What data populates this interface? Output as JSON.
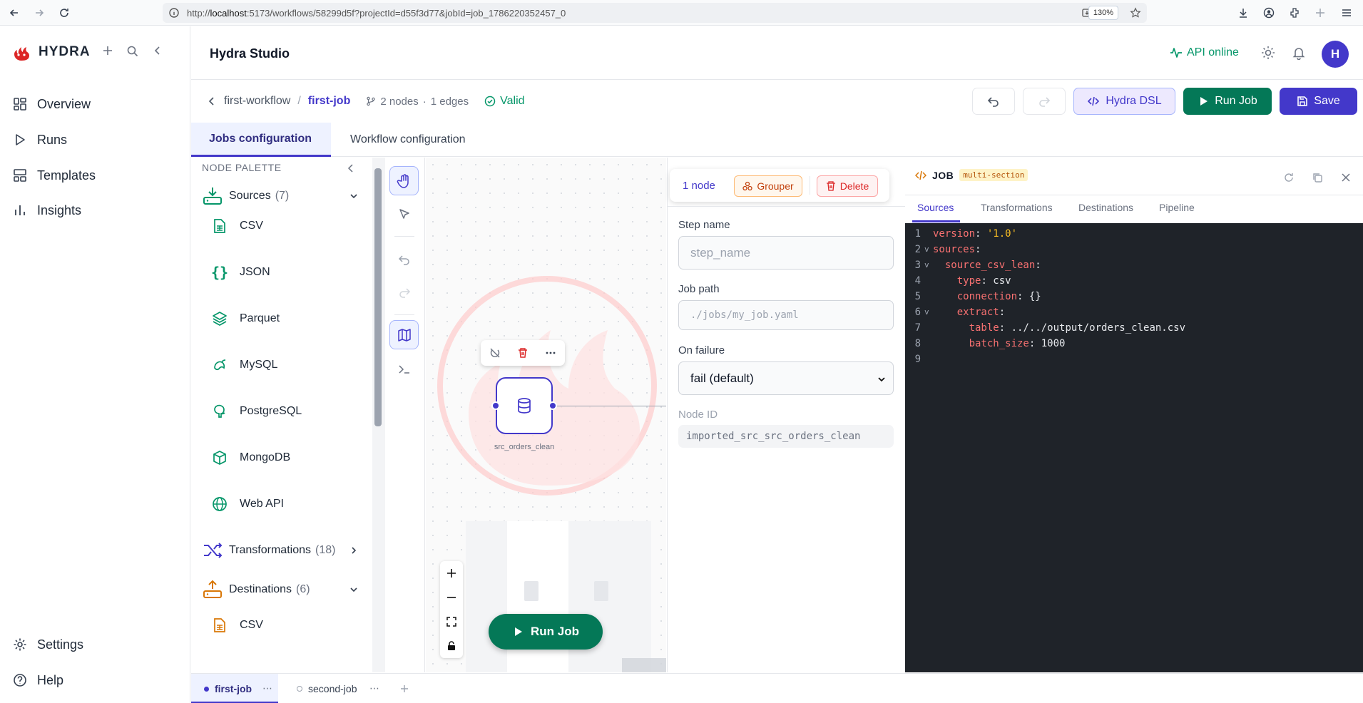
{
  "browser": {
    "url_prefix": "http://",
    "url_host": "localhost",
    "url_rest": ":5173/workflows/58299d5f?projectId=d55f3d77&jobId=job_1786220352457_0",
    "zoom": "130%"
  },
  "sidebar": {
    "brand": "HYDRA",
    "items": [
      {
        "label": "Overview",
        "icon": "grid-icon"
      },
      {
        "label": "Runs",
        "icon": "play-icon"
      },
      {
        "label": "Templates",
        "icon": "layout-icon"
      },
      {
        "label": "Insights",
        "icon": "bar-chart-icon"
      }
    ],
    "footer": [
      {
        "label": "Settings",
        "icon": "gear-icon"
      },
      {
        "label": "Help",
        "icon": "help-icon"
      }
    ]
  },
  "header": {
    "title": "Hydra Studio",
    "api_status": "API online",
    "avatar_initial": "H"
  },
  "toolbar": {
    "breadcrumb_workflow": "first-workflow",
    "breadcrumb_sep": "/",
    "breadcrumb_job": "first-job",
    "nodes": "2 nodes",
    "dot": "·",
    "edges": "1 edges",
    "status": "Valid",
    "dsl_label": "Hydra DSL",
    "run_label": "Run Job",
    "save_label": "Save"
  },
  "tabs": {
    "jobs": "Jobs configuration",
    "workflow": "Workflow configuration"
  },
  "palette": {
    "heading": "NODE PALETTE",
    "sources": {
      "label": "Sources",
      "count": "(7)"
    },
    "source_items": [
      "CSV",
      "JSON",
      "Parquet",
      "MySQL",
      "PostgreSQL",
      "MongoDB",
      "Web API"
    ],
    "transformations": {
      "label": "Transformations",
      "count": "(18)"
    },
    "destinations": {
      "label": "Destinations",
      "count": "(6)"
    },
    "destination_items": [
      "CSV"
    ]
  },
  "canvas": {
    "node_label": "src_orders_clean",
    "run_label": "Run Job"
  },
  "props": {
    "selection_count": "1 node",
    "grouper_label": "Grouper",
    "delete_label": "Delete",
    "step_name_label": "Step name",
    "step_name_placeholder": "step_name",
    "job_path_label": "Job path",
    "job_path_placeholder": "./jobs/my_job.yaml",
    "on_failure_label": "On failure",
    "on_failure_value": "fail (default)",
    "node_id_label": "Node ID",
    "node_id_value": "imported_src_src_orders_clean"
  },
  "code_panel": {
    "title": "JOB",
    "badge": "multi-section",
    "tabs": [
      "Sources",
      "Transformations",
      "Destinations",
      "Pipeline"
    ],
    "lines": [
      {
        "n": "1",
        "fold": "",
        "indent": "",
        "key": "version",
        "value": "'1.0'",
        "vtype": "s"
      },
      {
        "n": "2",
        "fold": "v",
        "indent": "",
        "key": "sources",
        "value": "",
        "vtype": "v"
      },
      {
        "n": "3",
        "fold": "v",
        "indent": "  ",
        "key": "source_csv_lean",
        "value": "",
        "vtype": "v"
      },
      {
        "n": "4",
        "fold": "",
        "indent": "    ",
        "key": "type",
        "value": "csv",
        "vtype": "v"
      },
      {
        "n": "5",
        "fold": "",
        "indent": "    ",
        "key": "connection",
        "value": "{}",
        "vtype": "v"
      },
      {
        "n": "6",
        "fold": "v",
        "indent": "    ",
        "key": "extract",
        "value": "",
        "vtype": "v"
      },
      {
        "n": "7",
        "fold": "",
        "indent": "      ",
        "key": "table",
        "value": "../../output/orders_clean.csv",
        "vtype": "v"
      },
      {
        "n": "8",
        "fold": "",
        "indent": "      ",
        "key": "batch_size",
        "value": "1000",
        "vtype": "v"
      },
      {
        "n": "9",
        "fold": "",
        "indent": "",
        "key": "",
        "value": "",
        "vtype": "v"
      }
    ]
  },
  "bottom_tabs": [
    {
      "label": "first-job",
      "active": true
    },
    {
      "label": "second-job",
      "active": false
    }
  ],
  "colors": {
    "accent": "#4338ca",
    "success": "#059669",
    "danger": "#dc2626",
    "warning": "#d97706"
  }
}
